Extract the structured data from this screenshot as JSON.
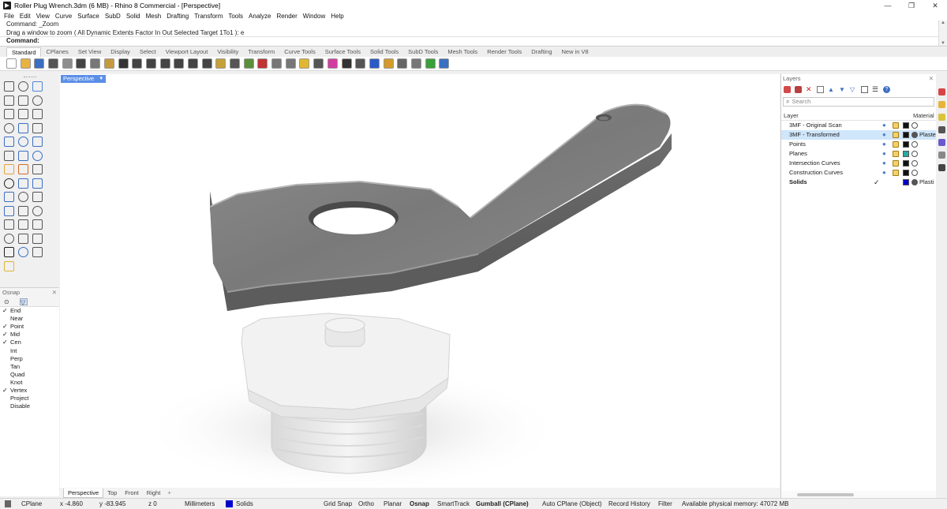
{
  "window": {
    "title": "Roller Plug Wrench.3dm (6 MB) - Rhino 8 Commercial - [Perspective]",
    "controls": [
      "—",
      "❐",
      "✕"
    ]
  },
  "menu": [
    "File",
    "Edit",
    "View",
    "Curve",
    "Surface",
    "SubD",
    "Solid",
    "Mesh",
    "Drafting",
    "Transform",
    "Tools",
    "Analyze",
    "Render",
    "Window",
    "Help"
  ],
  "command": {
    "history": [
      "Command: _Zoom",
      "Drag a window to zoom ( All  Dynamic  Extents  Factor  In  Out  Selected  Target  1To1 ): e"
    ],
    "prompt": "Command:"
  },
  "toolbar_tabs": [
    "Standard",
    "CPlanes",
    "Set View",
    "Display",
    "Select",
    "Viewport Layout",
    "Visibility",
    "Transform",
    "Curve Tools",
    "Surface Tools",
    "Solid Tools",
    "SubD Tools",
    "Mesh Tools",
    "Render Tools",
    "Drafting",
    "New in V8"
  ],
  "toolbar_tabs_active": "Standard",
  "standard_icons": [
    {
      "name": "new-icon",
      "color": "#ffffff"
    },
    {
      "name": "open-icon",
      "color": "#e8b341"
    },
    {
      "name": "save-icon",
      "color": "#3b6fc2"
    },
    {
      "name": "print-icon",
      "color": "#555555"
    },
    {
      "name": "import-icon",
      "color": "#8d8d8d"
    },
    {
      "name": "cut-icon",
      "color": "#444444"
    },
    {
      "name": "copy-icon",
      "color": "#777777"
    },
    {
      "name": "paste-icon",
      "color": "#c59a3f"
    },
    {
      "name": "undo-icon",
      "color": "#333333"
    },
    {
      "name": "pan-icon",
      "color": "#444444"
    },
    {
      "name": "rotate-view-icon",
      "color": "#444444"
    },
    {
      "name": "zoom-icon",
      "color": "#444444"
    },
    {
      "name": "zoom-window-icon",
      "color": "#444444"
    },
    {
      "name": "zoom-extents-icon",
      "color": "#444444"
    },
    {
      "name": "zoom-selected-icon",
      "color": "#444444"
    },
    {
      "name": "zoom-all-icon",
      "color": "#c6a13a"
    },
    {
      "name": "four-view-icon",
      "color": "#555555"
    },
    {
      "name": "cplane-icon",
      "color": "#5a8f3a"
    },
    {
      "name": "car-icon",
      "color": "#c03434"
    },
    {
      "name": "select-icon",
      "color": "#777777"
    },
    {
      "name": "lock-icon",
      "color": "#777777"
    },
    {
      "name": "light-icon",
      "color": "#e0b632"
    },
    {
      "name": "hide-icon",
      "color": "#555555"
    },
    {
      "name": "color-wheel-icon",
      "color": "#d23ca0"
    },
    {
      "name": "render-sphere-icon",
      "color": "#333333"
    },
    {
      "name": "display-mode-icon",
      "color": "#555555"
    },
    {
      "name": "render-icon",
      "color": "#2a5bc8"
    },
    {
      "name": "tools-icon",
      "color": "#d49a2b"
    },
    {
      "name": "settings-icon",
      "color": "#666666"
    },
    {
      "name": "layout-icon",
      "color": "#777777"
    },
    {
      "name": "grasshopper-icon",
      "color": "#3aa03a"
    },
    {
      "name": "help-icon",
      "color": "#3b6fc2"
    }
  ],
  "viewport": {
    "title": "Perspective",
    "tabs": [
      "Perspective",
      "Top",
      "Front",
      "Right"
    ],
    "active_tab": "Perspective",
    "add_tab": "+"
  },
  "osnap": {
    "title": "Osnap",
    "items": [
      {
        "label": "End",
        "checked": true
      },
      {
        "label": "Near",
        "checked": false
      },
      {
        "label": "Point",
        "checked": true
      },
      {
        "label": "Mid",
        "checked": true
      },
      {
        "label": "Cen",
        "checked": true
      },
      {
        "label": "Int",
        "checked": false
      },
      {
        "label": "Perp",
        "checked": false
      },
      {
        "label": "Tan",
        "checked": false
      },
      {
        "label": "Quad",
        "checked": false
      },
      {
        "label": "Knot",
        "checked": false
      },
      {
        "label": "Vertex",
        "checked": true
      },
      {
        "label": "Project",
        "checked": false
      },
      {
        "label": "Disable",
        "checked": false
      }
    ]
  },
  "layers": {
    "title": "Layers",
    "search_placeholder": "Search",
    "col_layer": "Layer",
    "col_material": "Material",
    "rows": [
      {
        "name": "3MF - Original Scan",
        "color": "#111111",
        "material": "",
        "bold": false,
        "selected": false,
        "current": false,
        "mat_filled": false
      },
      {
        "name": "3MF - Transformed",
        "color": "#111111",
        "material": "Plaste",
        "bold": false,
        "selected": true,
        "current": false,
        "mat_filled": true
      },
      {
        "name": "Points",
        "color": "#111111",
        "material": "",
        "bold": false,
        "selected": false,
        "current": false,
        "mat_filled": false
      },
      {
        "name": "Planes",
        "color": "#2aa99c",
        "material": "",
        "bold": false,
        "selected": false,
        "current": false,
        "mat_filled": false
      },
      {
        "name": "Intersection Curves",
        "color": "#111111",
        "material": "",
        "bold": false,
        "selected": false,
        "current": false,
        "mat_filled": false
      },
      {
        "name": "Construction Curves",
        "color": "#111111",
        "material": "",
        "bold": false,
        "selected": false,
        "current": false,
        "mat_filled": false
      },
      {
        "name": "Solids",
        "color": "#0000cc",
        "material": "Plasti",
        "bold": true,
        "selected": false,
        "current": true,
        "mat_filled": true
      }
    ],
    "current_mark": "✓"
  },
  "status": {
    "cplane": "CPlane",
    "x": "x -4.860",
    "y": "y -83.945",
    "z": "z 0",
    "units": "Millimeters",
    "layer": "Solids",
    "layer_color": "#0000cc",
    "grid_snap": "Grid Snap",
    "ortho": "Ortho",
    "planar": "Planar",
    "osnap": "Osnap",
    "smarttrack": "SmartTrack",
    "gumball": "Gumball (CPlane)",
    "auto_cplane": "Auto CPlane (Object)",
    "record_history": "Record History",
    "filter": "Filter",
    "memory": "Available physical memory: 47072 MB"
  }
}
